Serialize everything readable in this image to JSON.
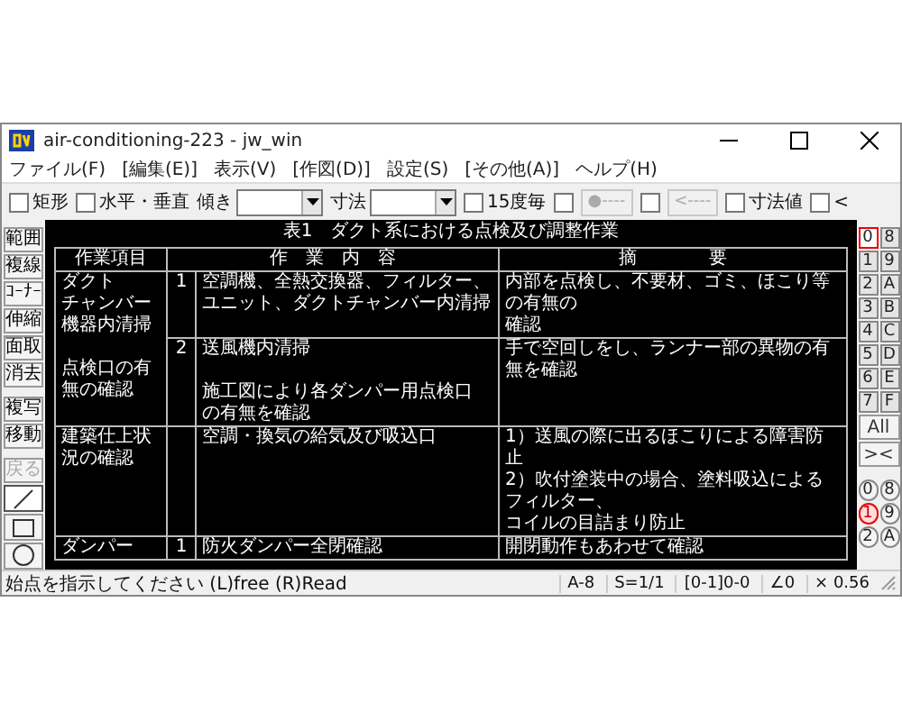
{
  "window": {
    "title": "air-conditioning-223 - jw_win"
  },
  "menu": [
    {
      "label": "ファイル(F)"
    },
    {
      "label": "[編集(E)]"
    },
    {
      "label": "表示(V)"
    },
    {
      "label": "[作図(D)]"
    },
    {
      "label": "設定(S)"
    },
    {
      "label": "[その他(A)]"
    },
    {
      "label": "ヘルプ(H)"
    }
  ],
  "toolbar": [
    {
      "kind": "checkbox",
      "label": "矩形",
      "checked": false
    },
    {
      "kind": "checkbox",
      "label": "水平・垂直",
      "checked": false
    },
    {
      "kind": "dropdown",
      "label": "傾き"
    },
    {
      "kind": "dropdown",
      "label": "寸法"
    },
    {
      "kind": "checkbox",
      "label": "15度毎",
      "checked": false
    },
    {
      "kind": "checkbox",
      "checked": false
    },
    {
      "kind": "button",
      "label": "●----",
      "disabled": true
    },
    {
      "kind": "checkbox",
      "checked": false
    },
    {
      "kind": "button",
      "label": "<----",
      "disabled": true
    },
    {
      "kind": "checkbox",
      "label": "寸法値",
      "checked": false
    },
    {
      "kind": "checkbox",
      "label": "<",
      "checked": false
    }
  ],
  "left_tools": [
    {
      "kind": "text",
      "label": "範囲",
      "disabled": false
    },
    {
      "kind": "text",
      "label": "複線",
      "disabled": false
    },
    {
      "kind": "text",
      "label": "ｺｰﾅｰ",
      "disabled": false
    },
    {
      "kind": "text",
      "label": "伸縮",
      "disabled": false
    },
    {
      "kind": "text",
      "label": "面取",
      "disabled": false
    },
    {
      "kind": "text",
      "label": "消去",
      "disabled": false
    },
    {
      "kind": "text",
      "label": "複写",
      "disabled": false
    },
    {
      "kind": "text",
      "label": "移動",
      "disabled": false
    },
    {
      "kind": "text",
      "label": "戻る",
      "disabled": true
    },
    {
      "kind": "line",
      "selected": true
    },
    {
      "kind": "rectangle",
      "selected": false
    },
    {
      "kind": "circle",
      "selected": false
    }
  ],
  "canvas": {
    "title": "表1　ダクト系における点検及び調整作業",
    "table": {
      "columns": [
        "作業項目",
        "作　業　内　容",
        "摘　　　　要"
      ],
      "groups": [
        {
          "item": [
            [
              "ダクト",
              "チャンバー",
              "機器内清掃"
            ],
            [
              "点検口の有",
              "無の確認"
            ]
          ],
          "entries": [
            {
              "no": "1",
              "content": [
                [
                  "空調機、全熱交換器、フィルター、",
                  "ユニット、ダクトチャンバー内清掃"
                ]
              ],
              "remarks": [
                [
                  "内部を点検し、不要材、ゴミ、ほこり等の有無の",
                  "確認"
                ]
              ]
            },
            {
              "no": "2",
              "content": [
                [
                  "送風機内清掃"
                ],
                [
                  "施工図により各ダンパー用点検口",
                  "の有無を確認"
                ]
              ],
              "remarks": [
                [
                  "手で空回しをし、ランナー部の異物の有無を確認"
                ]
              ]
            }
          ]
        },
        {
          "item": [
            [
              "建築仕上状",
              "況の確認"
            ]
          ],
          "entries": [
            {
              "content": [
                [
                  "空調・換気の給気及び吸込口"
                ]
              ],
              "remarks": [
                [
                  "1）送風の際に出るほこりによる障害防止",
                  "2）吹付塗装中の場合、塗料吸込によるフィルター、",
                  "コイルの目詰まり防止"
                ]
              ]
            }
          ]
        },
        {
          "item": [
            [
              "ダンパー"
            ]
          ],
          "entries": [
            {
              "no": "1",
              "content": [
                [
                  "防火ダンパー全閉確認"
                ]
              ],
              "remarks": [
                [
                  "開閉動作もあわせて確認"
                ]
              ]
            }
          ]
        }
      ]
    }
  },
  "layers": [
    {
      "label": "0",
      "selected": true
    },
    {
      "label": "8",
      "selected": false
    },
    {
      "label": "1",
      "selected": false
    },
    {
      "label": "9",
      "selected": false
    },
    {
      "label": "2",
      "selected": false
    },
    {
      "label": "A",
      "selected": false
    },
    {
      "label": "3",
      "selected": false
    },
    {
      "label": "B",
      "selected": false
    },
    {
      "label": "4",
      "selected": false
    },
    {
      "label": "C",
      "selected": false
    },
    {
      "label": "5",
      "selected": false
    },
    {
      "label": "D",
      "selected": false
    },
    {
      "label": "6",
      "selected": false
    },
    {
      "label": "E",
      "selected": false
    },
    {
      "label": "7",
      "selected": false
    },
    {
      "label": "F",
      "selected": false
    }
  ],
  "layer_buttons": [
    "All",
    "><"
  ],
  "groups": [
    {
      "label": "0",
      "selected": false
    },
    {
      "label": "8",
      "selected": false
    },
    {
      "label": "1",
      "selected": true
    },
    {
      "label": "9",
      "selected": false
    },
    {
      "label": "2",
      "selected": false
    },
    {
      "label": "A",
      "selected": false
    }
  ],
  "status_bar": {
    "message": "始点を指示してください (L)free (R)Read",
    "fields": [
      "A-8",
      "S=1/1",
      "[0-1]0-0",
      "∠0",
      "× 0.56"
    ]
  }
}
